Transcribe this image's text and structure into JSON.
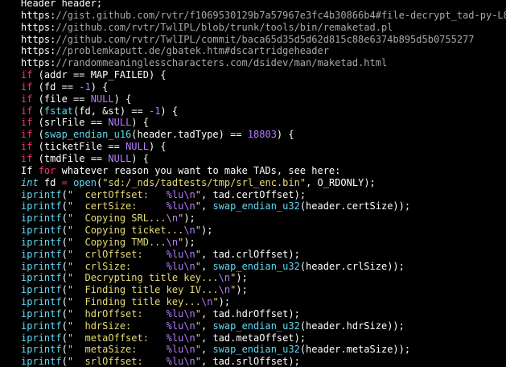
{
  "colors": {
    "background": "#000000",
    "plain": "#ffffff",
    "comment": "#a8a8a8",
    "keyword": "#ff2f7a",
    "number": "#b67dff",
    "function": "#62d8f1",
    "string": "#e7db74",
    "type": "#62d8f1"
  },
  "code": {
    "lines": [
      [
        {
          "t": "Header header;",
          "k": "plain"
        }
      ],
      [
        {
          "t": "https:",
          "k": "plain"
        },
        {
          "t": "//gist.github.com/rvtr/f1069530129b7a57967e3fc4b30866b4#file-decrypt_tad-py-L84",
          "k": "comment"
        }
      ],
      [
        {
          "t": "https:",
          "k": "plain"
        },
        {
          "t": "//github.com/rvtr/TwlIPL/blob/trunk/tools/bin/remaketad.pl",
          "k": "comment"
        }
      ],
      [
        {
          "t": "https:",
          "k": "plain"
        },
        {
          "t": "//github.com/rvtr/TwlIPL/commit/baca65d35d5d62d815c88e6374b895d5b0755277",
          "k": "comment"
        }
      ],
      [
        {
          "t": "https:",
          "k": "plain"
        },
        {
          "t": "//problemkaputt.de/gbatek.htm#dscartridgeheader",
          "k": "comment"
        }
      ],
      [
        {
          "t": "https:",
          "k": "plain"
        },
        {
          "t": "//randommeaninglesscharacters.com/dsidev/man/maketad.html",
          "k": "comment"
        }
      ],
      [
        {
          "t": "if",
          "k": "keyword"
        },
        {
          "t": " (addr ",
          "k": "plain"
        },
        {
          "t": "==",
          "k": "plain"
        },
        {
          "t": " MAP_FAILED) {",
          "k": "plain"
        }
      ],
      [
        {
          "t": "if",
          "k": "keyword"
        },
        {
          "t": " (fd ",
          "k": "plain"
        },
        {
          "t": "==",
          "k": "plain"
        },
        {
          "t": " ",
          "k": "plain"
        },
        {
          "t": "-1",
          "k": "number"
        },
        {
          "t": ") {",
          "k": "plain"
        }
      ],
      [
        {
          "t": "if",
          "k": "keyword"
        },
        {
          "t": " (file ",
          "k": "plain"
        },
        {
          "t": "==",
          "k": "plain"
        },
        {
          "t": " ",
          "k": "plain"
        },
        {
          "t": "NULL",
          "k": "number"
        },
        {
          "t": ") {",
          "k": "plain"
        }
      ],
      [
        {
          "t": "if",
          "k": "keyword"
        },
        {
          "t": " (",
          "k": "plain"
        },
        {
          "t": "fstat",
          "k": "function"
        },
        {
          "t": "(fd, &st) ",
          "k": "plain"
        },
        {
          "t": "==",
          "k": "plain"
        },
        {
          "t": " ",
          "k": "plain"
        },
        {
          "t": "-1",
          "k": "number"
        },
        {
          "t": ") {",
          "k": "plain"
        }
      ],
      [
        {
          "t": "if",
          "k": "keyword"
        },
        {
          "t": " (srlFile ",
          "k": "plain"
        },
        {
          "t": "==",
          "k": "plain"
        },
        {
          "t": " ",
          "k": "plain"
        },
        {
          "t": "NULL",
          "k": "number"
        },
        {
          "t": ") {",
          "k": "plain"
        }
      ],
      [
        {
          "t": "if",
          "k": "keyword"
        },
        {
          "t": " (",
          "k": "plain"
        },
        {
          "t": "swap_endian_u16",
          "k": "function"
        },
        {
          "t": "(header.tadType) ",
          "k": "plain"
        },
        {
          "t": "==",
          "k": "plain"
        },
        {
          "t": " ",
          "k": "plain"
        },
        {
          "t": "18803",
          "k": "number"
        },
        {
          "t": ") {",
          "k": "plain"
        }
      ],
      [
        {
          "t": "if",
          "k": "keyword"
        },
        {
          "t": " (ticketFile ",
          "k": "plain"
        },
        {
          "t": "==",
          "k": "plain"
        },
        {
          "t": " ",
          "k": "plain"
        },
        {
          "t": "NULL",
          "k": "number"
        },
        {
          "t": ") {",
          "k": "plain"
        }
      ],
      [
        {
          "t": "if",
          "k": "keyword"
        },
        {
          "t": " (tmdFile ",
          "k": "plain"
        },
        {
          "t": "==",
          "k": "plain"
        },
        {
          "t": " ",
          "k": "plain"
        },
        {
          "t": "NULL",
          "k": "number"
        },
        {
          "t": ") {",
          "k": "plain"
        }
      ],
      [
        {
          "t": "If ",
          "k": "plain"
        },
        {
          "t": "for",
          "k": "keyword"
        },
        {
          "t": " whatever reason you want to make TADs, see here:",
          "k": "plain"
        }
      ],
      [
        {
          "t": "int",
          "k": "type"
        },
        {
          "t": " fd ",
          "k": "plain"
        },
        {
          "t": "=",
          "k": "keyword"
        },
        {
          "t": " ",
          "k": "plain"
        },
        {
          "t": "open",
          "k": "function"
        },
        {
          "t": "(",
          "k": "plain"
        },
        {
          "t": "\"sd:/_nds/tadtests/tmp/srl_enc.bin\"",
          "k": "string"
        },
        {
          "t": ", O_RDONLY);",
          "k": "plain"
        }
      ],
      [
        {
          "t": "iprintf",
          "k": "function"
        },
        {
          "t": "(",
          "k": "plain"
        },
        {
          "t": "\"  certOffset:   ",
          "k": "string"
        },
        {
          "t": "%lu\\n",
          "k": "number"
        },
        {
          "t": "\"",
          "k": "string"
        },
        {
          "t": ", tad.certOffset);",
          "k": "plain"
        }
      ],
      [
        {
          "t": "iprintf",
          "k": "function"
        },
        {
          "t": "(",
          "k": "plain"
        },
        {
          "t": "\"  certSize:     ",
          "k": "string"
        },
        {
          "t": "%lu\\n",
          "k": "number"
        },
        {
          "t": "\"",
          "k": "string"
        },
        {
          "t": ", ",
          "k": "plain"
        },
        {
          "t": "swap_endian_u32",
          "k": "function"
        },
        {
          "t": "(header.certSize));",
          "k": "plain"
        }
      ],
      [
        {
          "t": "iprintf",
          "k": "function"
        },
        {
          "t": "(",
          "k": "plain"
        },
        {
          "t": "\"  Copying SRL...",
          "k": "string"
        },
        {
          "t": "\\n",
          "k": "number"
        },
        {
          "t": "\"",
          "k": "string"
        },
        {
          "t": ");",
          "k": "plain"
        }
      ],
      [
        {
          "t": "iprintf",
          "k": "function"
        },
        {
          "t": "(",
          "k": "plain"
        },
        {
          "t": "\"  Copying ticket...",
          "k": "string"
        },
        {
          "t": "\\n",
          "k": "number"
        },
        {
          "t": "\"",
          "k": "string"
        },
        {
          "t": ");",
          "k": "plain"
        }
      ],
      [
        {
          "t": "iprintf",
          "k": "function"
        },
        {
          "t": "(",
          "k": "plain"
        },
        {
          "t": "\"  Copying TMD...",
          "k": "string"
        },
        {
          "t": "\\n",
          "k": "number"
        },
        {
          "t": "\"",
          "k": "string"
        },
        {
          "t": ");",
          "k": "plain"
        }
      ],
      [
        {
          "t": "iprintf",
          "k": "function"
        },
        {
          "t": "(",
          "k": "plain"
        },
        {
          "t": "\"  crlOffset:    ",
          "k": "string"
        },
        {
          "t": "%lu\\n",
          "k": "number"
        },
        {
          "t": "\"",
          "k": "string"
        },
        {
          "t": ", tad.crlOffset);",
          "k": "plain"
        }
      ],
      [
        {
          "t": "iprintf",
          "k": "function"
        },
        {
          "t": "(",
          "k": "plain"
        },
        {
          "t": "\"  crlSize:      ",
          "k": "string"
        },
        {
          "t": "%lu\\n",
          "k": "number"
        },
        {
          "t": "\"",
          "k": "string"
        },
        {
          "t": ", ",
          "k": "plain"
        },
        {
          "t": "swap_endian_u32",
          "k": "function"
        },
        {
          "t": "(header.crlSize));",
          "k": "plain"
        }
      ],
      [
        {
          "t": "iprintf",
          "k": "function"
        },
        {
          "t": "(",
          "k": "plain"
        },
        {
          "t": "\"  Decrypting title key...",
          "k": "string"
        },
        {
          "t": "\\n",
          "k": "number"
        },
        {
          "t": "\"",
          "k": "string"
        },
        {
          "t": ");",
          "k": "plain"
        }
      ],
      [
        {
          "t": "iprintf",
          "k": "function"
        },
        {
          "t": "(",
          "k": "plain"
        },
        {
          "t": "\"  Finding title key IV...",
          "k": "string"
        },
        {
          "t": "\\n",
          "k": "number"
        },
        {
          "t": "\"",
          "k": "string"
        },
        {
          "t": ");",
          "k": "plain"
        }
      ],
      [
        {
          "t": "iprintf",
          "k": "function"
        },
        {
          "t": "(",
          "k": "plain"
        },
        {
          "t": "\"  Finding title key...",
          "k": "string"
        },
        {
          "t": "\\n",
          "k": "number"
        },
        {
          "t": "\"",
          "k": "string"
        },
        {
          "t": ");",
          "k": "plain"
        }
      ],
      [
        {
          "t": "iprintf",
          "k": "function"
        },
        {
          "t": "(",
          "k": "plain"
        },
        {
          "t": "\"  hdrOffset:    ",
          "k": "string"
        },
        {
          "t": "%lu\\n",
          "k": "number"
        },
        {
          "t": "\"",
          "k": "string"
        },
        {
          "t": ", tad.hdrOffset);",
          "k": "plain"
        }
      ],
      [
        {
          "t": "iprintf",
          "k": "function"
        },
        {
          "t": "(",
          "k": "plain"
        },
        {
          "t": "\"  hdrSize:      ",
          "k": "string"
        },
        {
          "t": "%lu\\n",
          "k": "number"
        },
        {
          "t": "\"",
          "k": "string"
        },
        {
          "t": ", ",
          "k": "plain"
        },
        {
          "t": "swap_endian_u32",
          "k": "function"
        },
        {
          "t": "(header.hdrSize));",
          "k": "plain"
        }
      ],
      [
        {
          "t": "iprintf",
          "k": "function"
        },
        {
          "t": "(",
          "k": "plain"
        },
        {
          "t": "\"  metaOffset:   ",
          "k": "string"
        },
        {
          "t": "%lu\\n",
          "k": "number"
        },
        {
          "t": "\"",
          "k": "string"
        },
        {
          "t": ", tad.metaOffset);",
          "k": "plain"
        }
      ],
      [
        {
          "t": "iprintf",
          "k": "function"
        },
        {
          "t": "(",
          "k": "plain"
        },
        {
          "t": "\"  metaSize:     ",
          "k": "string"
        },
        {
          "t": "%lu\\n",
          "k": "number"
        },
        {
          "t": "\"",
          "k": "string"
        },
        {
          "t": ", ",
          "k": "plain"
        },
        {
          "t": "swap_endian_u32",
          "k": "function"
        },
        {
          "t": "(header.metaSize));",
          "k": "plain"
        }
      ],
      [
        {
          "t": "iprintf",
          "k": "function"
        },
        {
          "t": "(",
          "k": "plain"
        },
        {
          "t": "\"  srlOffset:    ",
          "k": "string"
        },
        {
          "t": "%lu\\n",
          "k": "number"
        },
        {
          "t": "\"",
          "k": "string"
        },
        {
          "t": ", tad.srlOffset);",
          "k": "plain"
        }
      ]
    ]
  }
}
